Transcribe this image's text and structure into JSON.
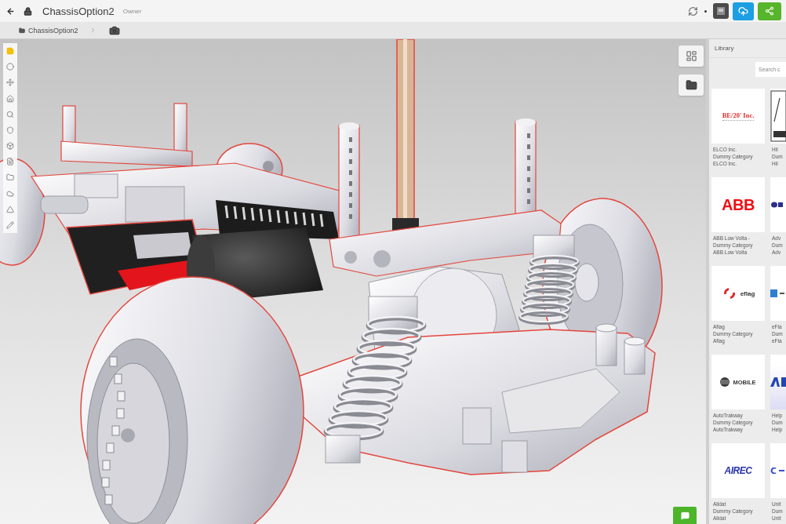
{
  "header": {
    "title": "ChassisOption2",
    "badge": "Owner"
  },
  "breadcrumb": [
    "ChassisOption2"
  ],
  "toolbar": [
    {
      "selected": true
    },
    {
      "selected": false
    },
    {
      "selected": false
    },
    {
      "selected": false
    },
    {
      "selected": false
    },
    {
      "selected": false
    },
    {
      "selected": false
    },
    {
      "selected": false
    },
    {
      "selected": false
    },
    {
      "selected": false
    },
    {
      "selected": false
    },
    {
      "selected": false
    }
  ],
  "library": {
    "title": "Library",
    "search": {
      "placeholder": "Search c"
    },
    "cards": [
      {
        "logo": {
          "kind": "serif",
          "text": "BE/20' Inc."
        },
        "lines": [
          "ELCO Inc.",
          "Dummy Category",
          "ELCO Inc."
        ]
      },
      {
        "logo": {
          "kind": "frame"
        },
        "lines": [
          "Hil",
          "Dum",
          "Hil"
        ]
      },
      {
        "logo": {
          "kind": "bold",
          "text": "ABB"
        },
        "lines": [
          "ABB Low Volta -",
          "Dummy Category",
          "ABB Low Volta"
        ]
      },
      {
        "logo": {
          "kind": "letter"
        },
        "lines": [
          "Adv",
          "Dum",
          "Adv"
        ]
      },
      {
        "logo": {
          "kind": "swirl",
          "text": "eflag"
        },
        "lines": [
          "Aflag",
          "Dummy Category",
          "Aflag"
        ]
      },
      {
        "logo": {
          "kind": "square"
        },
        "lines": [
          "eFla",
          "Dum",
          "eFla"
        ]
      },
      {
        "logo": {
          "kind": "sphere",
          "text": "MOBILE"
        },
        "lines": [
          "AutoTrakway",
          "Dummy Category",
          "AutoTrakway"
        ]
      },
      {
        "logo": {
          "kind": "lavender"
        },
        "lines": [
          "Help",
          "Dum",
          "Help"
        ]
      },
      {
        "logo": {
          "kind": "italic",
          "text": "AIREC"
        },
        "lines": [
          "Alldat",
          "Dummy Category",
          "Alldat"
        ]
      },
      {
        "logo": {
          "kind": "dash"
        },
        "lines": [
          "Unit",
          "Dum",
          "Unit"
        ]
      }
    ]
  }
}
